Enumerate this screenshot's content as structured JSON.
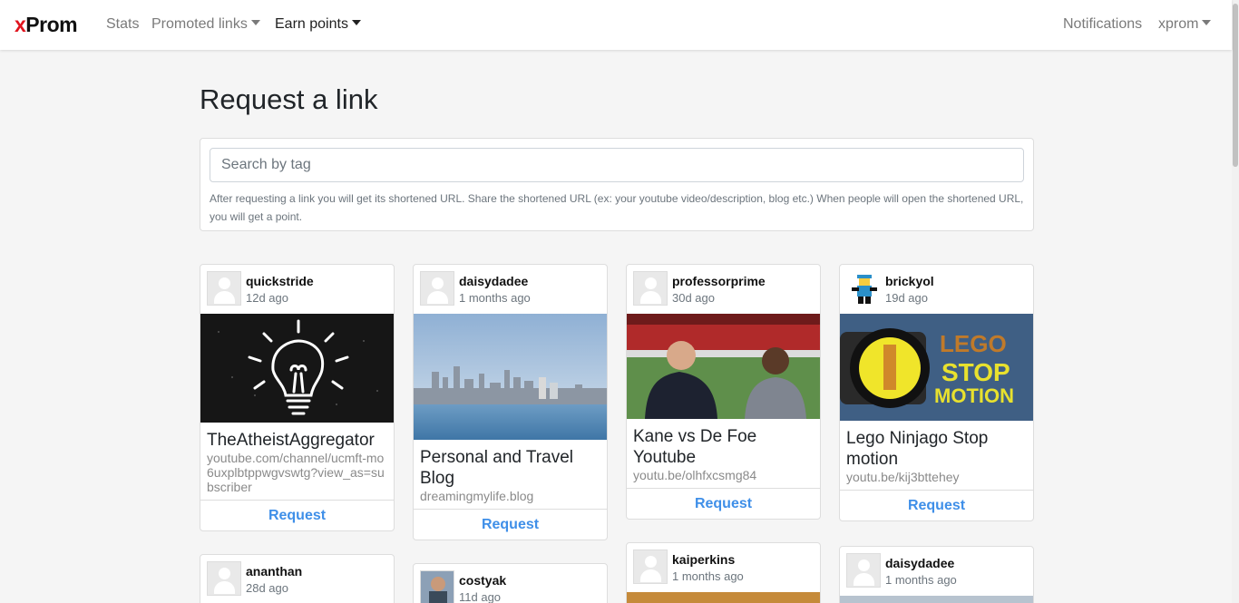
{
  "nav": {
    "brand_x": "x",
    "brand_rest": "Prom",
    "stats": "Stats",
    "promoted_links": "Promoted links",
    "earn_points": "Earn points",
    "notifications": "Notifications",
    "user": "xprom"
  },
  "page": {
    "title": "Request a link",
    "search_placeholder": "Search by tag",
    "help_text": "After requesting a link you will get its shortened URL. Share the shortened URL (ex: your youtube video/description, blog etc.) When people will open the shortened URL, you will get a point."
  },
  "colors": {
    "brand_accent": "#e0141e",
    "request_link": "#3f8fe8",
    "background": "#f5f5f5"
  },
  "cards": [
    {
      "user": "quickstride",
      "time": "12d ago",
      "title": "TheAtheistAggregator",
      "url": "youtube.com/channel/ucmft-mo6uxplbtppwgvswtg?view_as=subscriber",
      "action": "Request",
      "thumb": "lightbulb-chalk"
    },
    {
      "user": "daisydadee",
      "time": "1 months ago",
      "title": "Personal and Travel Blog",
      "url": "dreamingmylife.blog",
      "action": "Request",
      "thumb": "city-skyline"
    },
    {
      "user": "professorprime",
      "time": "30d ago",
      "title": "Kane vs De Foe Youtube",
      "url": "youtu.be/olhfxcsmg84",
      "action": "Request",
      "thumb": "football-stadium"
    },
    {
      "user": "brickyol",
      "time": "19d ago",
      "title": "Lego Ninjago Stop motion",
      "url": "youtu.be/kij3bttehey",
      "action": "Request",
      "thumb": "lego-stop-motion",
      "thumb_text_1": "LEGO",
      "thumb_text_2": "STOP",
      "thumb_text_3": "MOTION"
    },
    {
      "user": "ananthan",
      "time": "28d ago"
    },
    {
      "user": "costyak",
      "time": "11d ago"
    },
    {
      "user": "kaiperkins",
      "time": "1 months ago"
    },
    {
      "user": "daisydadee",
      "time": "1 months ago"
    }
  ]
}
